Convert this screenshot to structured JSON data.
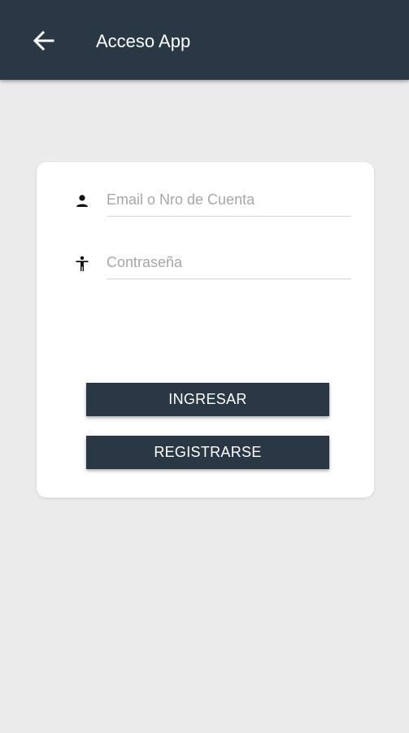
{
  "app_bar": {
    "title": "Acceso App",
    "back_icon": "arrow-left-icon",
    "background": "#2a3845"
  },
  "login_form": {
    "email": {
      "icon": "person-icon",
      "placeholder": "Email o Nro de Cuenta",
      "value": ""
    },
    "password": {
      "icon": "accessibility-icon",
      "placeholder": "Contraseña",
      "value": ""
    },
    "login_button_label": "INGRESAR",
    "register_button_label": "REGISTRARSE"
  },
  "colors": {
    "primary": "#2a3845",
    "background": "#ebebeb",
    "card": "#ffffff"
  }
}
